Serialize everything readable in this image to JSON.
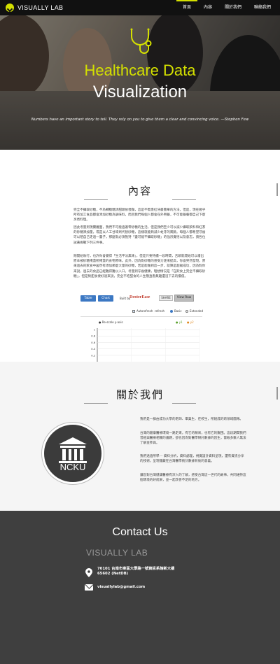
{
  "nav": {
    "brand": "VISUALLY LAB",
    "items": [
      {
        "label": "首頁",
        "active": true
      },
      {
        "label": "內容",
        "active": false
      },
      {
        "label": "關於我們",
        "active": false
      },
      {
        "label": "聯絡我們",
        "active": false
      }
    ]
  },
  "hero": {
    "title_line1": "Healthcare Data",
    "title_line2": "Visualization",
    "quote": "Numbers have an important story to tell. They rely on you to give them a clear and convincing voice. —Stephen Few",
    "accent_color": "#d4e000"
  },
  "content": {
    "title": "內容",
    "paragraphs": [
      "完全不攝取砂糖，不為轉糖糖詩甜頭依偎傷，這是不需患紅牙最簡單的方法，但是，現在幾乎所有加工食品都會添加砂糖為調味料，而且我們每個人都會在外用餐，不可能餐餐都自己下廚烹煮料理。",
      "因此考量到現實層面，我們不可能過著零砂糖的生活，但是我們至少可以減少攝取飲料和紅茶的砂糖添加量，或是以人工甘味劑代替砂糖，這樣就能夠減少蛀牙的風險。每個人都希望牙齒可以陪自己走過一輩子，那麼就必須抱持「盡可能不攝取砂糖」的強烈覺悟以及意志，請各位試著挑戰下列三件事。",
      "剛開始執行，也許你會覺得「生活平淡無味」，但是只要持續一段時間，舌頭就開始可以嚐出原本被砂糖掩蓋所掩蓋的食物原味。此外，因為對砂糖的感受力逐漸提高，你會突然發現，原來過去的飲食中居然有添加那麼大量的砂糖，若是能做到這一步，就算是超級成功，因為對你來說，過去的食品已經難得難以入口。考量到牙齒健康，理想情況是「在飲食上完全不攝取砂糖」，但是對甜食要好速來說，完全不吃甜食的人生簡直看無趣還沒下去的價值。"
    ],
    "widget": {
      "buttons": [
        "Table",
        "Chart"
      ],
      "built_by": "Built by",
      "logo": "DexterEase",
      "share": "SHARE",
      "view_raw": "View Raw",
      "options": [
        "Autorefresh",
        "refresh",
        "Basic",
        "Extended"
      ],
      "chart_legend": [
        "Re-scale y-axis",
        "y1",
        "y2"
      ],
      "chart_data": {
        "type": "line",
        "title": "",
        "xlabel": "",
        "ylabel": "",
        "yticks": [
          "1",
          "0.8",
          "0.6",
          "0.4",
          "0.2"
        ],
        "series": [],
        "grid": true
      }
    }
  },
  "about": {
    "title": "關於我們",
    "logo_text": "NCKU",
    "paragraphs": [
      "我們是一群由成功大學的老師、畢業生、在校生，所組成的跨領域團隊。",
      "台灣的健康醫療環境一路走來，有它的精采，也有它的艱困。這段期間我們曾經與醫療相關的議題，卻也因為對醫學研討數據的因生，嘗敢多數人無法了解並參與。",
      "我們透過所學 -- 資料分析，資料處理，視覺設計資料呈現，還有資訊分享的技術，呈現隱藏在台灣醫學統計數據背後的意義。",
      "讓您對台灣健康醫療有深入的了解，感受台灣這一世代的故事，共同維持這個環境的好成果，並一起改善不足的地方。"
    ]
  },
  "contact": {
    "title": "Contact Us",
    "brand": "VISUALLY LAB",
    "address_line1": "70101 台南市東區大學路一號資訊系館新大樓",
    "address_line2": "65602 (NetDB)",
    "email": "visuallylab@gmail.com"
  }
}
